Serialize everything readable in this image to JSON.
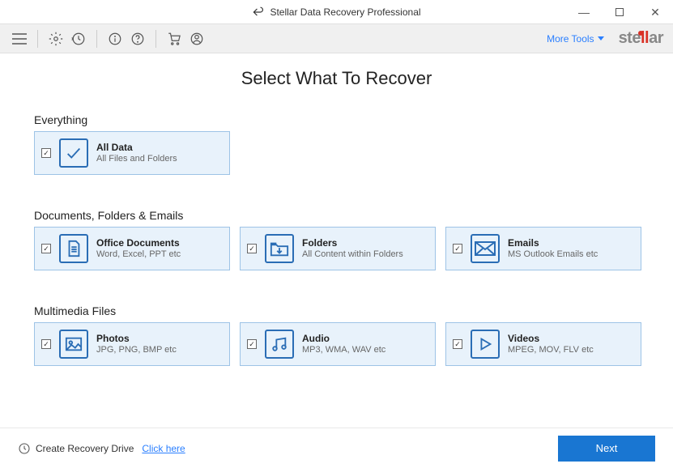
{
  "window": {
    "title": "Stellar Data Recovery Professional"
  },
  "toolbar": {
    "more_tools": "More Tools",
    "brand_left": "ste",
    "brand_mid": "ll",
    "brand_right": "ar"
  },
  "page": {
    "title": "Select What To Recover"
  },
  "sections": {
    "everything": {
      "label": "Everything",
      "card": {
        "title": "All Data",
        "desc": "All Files and Folders"
      }
    },
    "documents": {
      "label": "Documents, Folders & Emails",
      "cards": [
        {
          "title": "Office Documents",
          "desc": "Word, Excel, PPT etc"
        },
        {
          "title": "Folders",
          "desc": "All Content within Folders"
        },
        {
          "title": "Emails",
          "desc": "MS Outlook Emails etc"
        }
      ]
    },
    "multimedia": {
      "label": "Multimedia Files",
      "cards": [
        {
          "title": "Photos",
          "desc": "JPG, PNG, BMP etc"
        },
        {
          "title": "Audio",
          "desc": "MP3, WMA, WAV etc"
        },
        {
          "title": "Videos",
          "desc": "MPEG, MOV, FLV etc"
        }
      ]
    }
  },
  "footer": {
    "drive_label": "Create Recovery Drive",
    "drive_link": "Click here",
    "next": "Next"
  }
}
